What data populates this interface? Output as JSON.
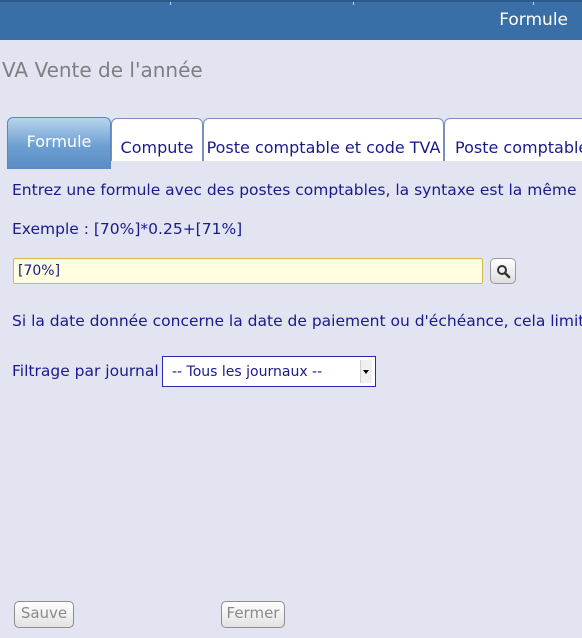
{
  "header": {
    "title": "Formule"
  },
  "page": {
    "title": "VA Vente de l'année"
  },
  "tabs": [
    {
      "label": "Formule",
      "active": true
    },
    {
      "label": "Compute",
      "active": false
    },
    {
      "label": "Poste comptable et code TVA",
      "active": false
    },
    {
      "label": "Poste comptable",
      "active": false
    }
  ],
  "formula": {
    "instruction": "Entrez une formule avec des postes comptables, la syntaxe est la même que",
    "example": "Exemple : [70%]*0.25+[71%]",
    "value": "[70%]"
  },
  "date_note": "Si la date donnée concerne la date de paiement ou d'échéance, cela limitera",
  "journal_filter": {
    "label": "Filtrage par journal",
    "selected": "-- Tous les journaux --"
  },
  "buttons": {
    "save": "Sauve",
    "close": "Fermer"
  },
  "colors": {
    "header_bg": "#3a6ea6",
    "active_tab": "#6d9fd1",
    "page_bg": "#e2e4f2",
    "text": "#1a1a8c",
    "input_bg": "#ffffe0"
  },
  "icons": {
    "search": "magnifier-icon"
  }
}
